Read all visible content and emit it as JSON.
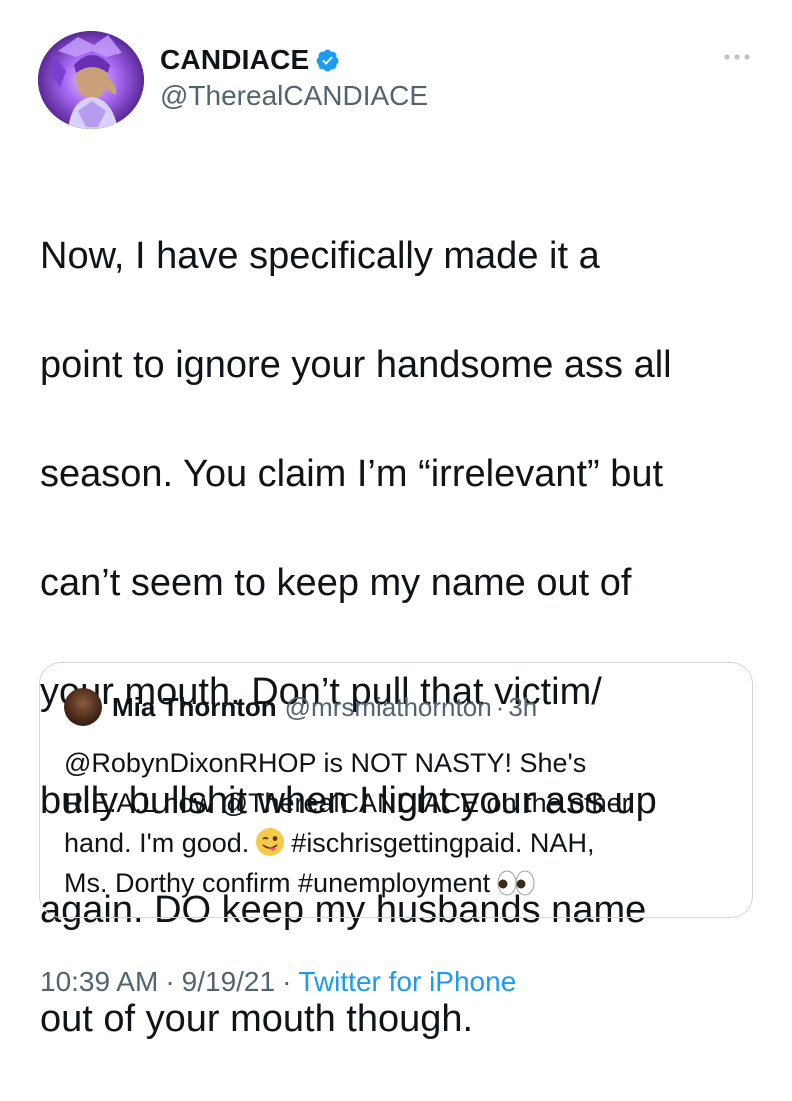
{
  "author": {
    "name": "CANDIACE",
    "handle": "@TherealCANDIACE",
    "verified": true
  },
  "tweet": {
    "text_lines": [
      "Now, I have specifically made it a",
      "point to ignore your handsome ass all",
      "season. You claim I’m “irrelevant” but",
      "can’t seem to keep my name out of",
      "your mouth. Don’t pull that victim/",
      "bully bullshit when I light your ass up",
      "again. DO keep my husbands name",
      "out of your mouth though."
    ]
  },
  "quote": {
    "name": "Mia Thornton",
    "handle": "@mrsmiathornton",
    "separator": "·",
    "time": "3h",
    "line1": "@RobynDixonRHOP is NOT NASTY!  She's",
    "line2": "R.E.A.L now @TherealCANDIACE on the other",
    "line3_before_emoji": "hand.  I'm good.",
    "line3_after_emoji": "#ischrisgettingpaid. NAH,",
    "line4": "Ms. Dorthy confirm #unemployment",
    "emojis": [
      "winking-tongue-face",
      "eyes"
    ]
  },
  "footer": {
    "time": "10:39 AM",
    "separator": "·",
    "date": "9/19/21",
    "source": "Twitter for iPhone"
  },
  "colors": {
    "text": "#0f1419",
    "secondary": "#536471",
    "accent": "#1d9bf0",
    "border": "#cfd9de"
  },
  "icons": {
    "verified": "verified-badge-icon",
    "more": "more-options-icon"
  }
}
